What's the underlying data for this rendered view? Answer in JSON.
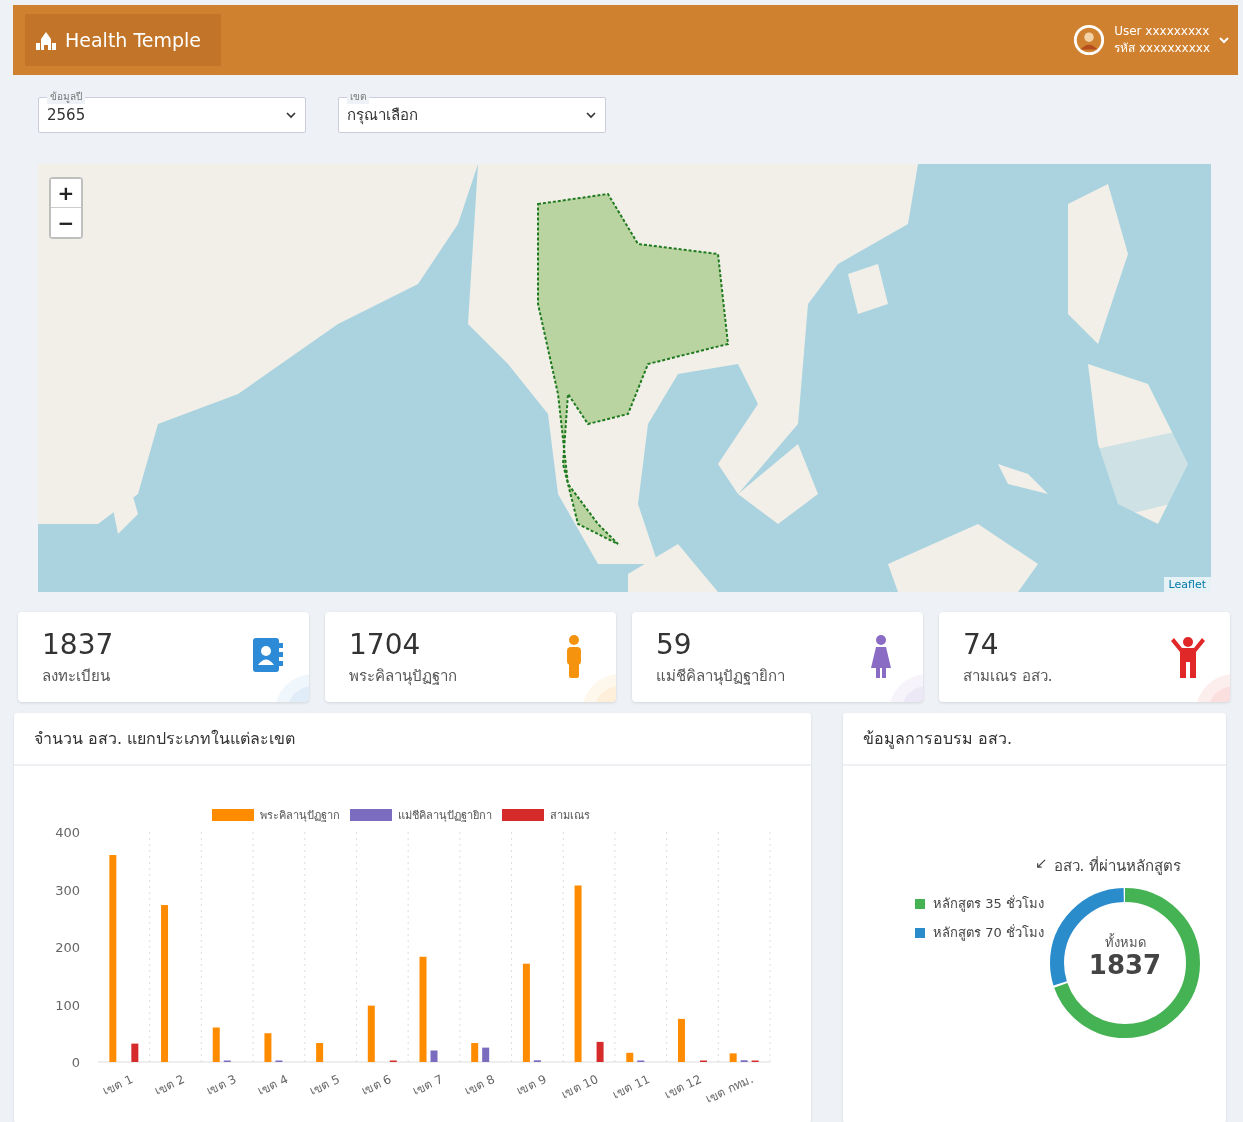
{
  "header": {
    "brand": "Health Temple",
    "user": {
      "name": "User xxxxxxxxx",
      "code": "รหัส xxxxxxxxxx"
    }
  },
  "filters": [
    {
      "label": "ข้อมูลปี",
      "value": "2565"
    },
    {
      "label": "เขต",
      "value": "กรุณาเลือก"
    }
  ],
  "map": {
    "kind": "picture",
    "zoom_in": "+",
    "zoom_out": "−",
    "attribution": "Leaflet"
  },
  "stats": [
    {
      "value": "1837",
      "label": "ลงทะเบียน",
      "kind": "book",
      "color": "#2d8ad6"
    },
    {
      "value": "1704",
      "label": "พระคิลานุปัฏฐาก",
      "kind": "man",
      "color": "#f5930f"
    },
    {
      "value": "59",
      "label": "แม่ชีคิลานุปัฏฐายิกา",
      "kind": "woman",
      "color": "#8a6cc4"
    },
    {
      "value": "74",
      "label": "สามเณร อสว.",
      "kind": "child",
      "color": "#e02828"
    }
  ],
  "bar_panel": {
    "title": "จำนวน อสว. แยกประเภทในแต่ละเขต",
    "chart_data": {
      "type": "bar",
      "categories": [
        "เขต 1",
        "เขต 2",
        "เขต 3",
        "เขต 4",
        "เขต 5",
        "เขต 6",
        "เขต 7",
        "เขต 8",
        "เขต 9",
        "เขต 10",
        "เขต 11",
        "เขต 12",
        "เขต กทม."
      ],
      "ylim": [
        0,
        400
      ],
      "legend": true,
      "yticks": [
        0,
        100,
        200,
        300,
        400
      ],
      "series": [
        {
          "name": "พระคิลานุปัฏฐาก",
          "color": "#ff8c00",
          "values": [
            360,
            273,
            60,
            50,
            33,
            98,
            183,
            33,
            171,
            307,
            16,
            75,
            15
          ]
        },
        {
          "name": "แม่ชีคิลานุปัฏฐายิกา",
          "color": "#7b6cc0",
          "values": [
            0,
            0,
            1,
            1,
            0,
            0,
            20,
            25,
            3,
            0,
            1,
            0,
            3
          ]
        },
        {
          "name": "สามเณร",
          "color": "#d62b2b",
          "values": [
            32,
            0,
            0,
            0,
            0,
            1,
            0,
            0,
            0,
            35,
            0,
            1,
            1
          ]
        }
      ]
    }
  },
  "training_panel": {
    "title": "ข้อมูลการอบรม อสว.",
    "caption_icon": "↙",
    "caption": "อสว. ที่ผ่านหลักสูตร",
    "legend": [
      {
        "label": "หลักสูตร 35 ชั่วโมง",
        "color": "#45b254"
      },
      {
        "label": "หลักสูตร 70 ชั่วโมง",
        "color": "#2b8ccc"
      }
    ],
    "center_label": "ทั้งหมด",
    "center_value": "1837"
  }
}
